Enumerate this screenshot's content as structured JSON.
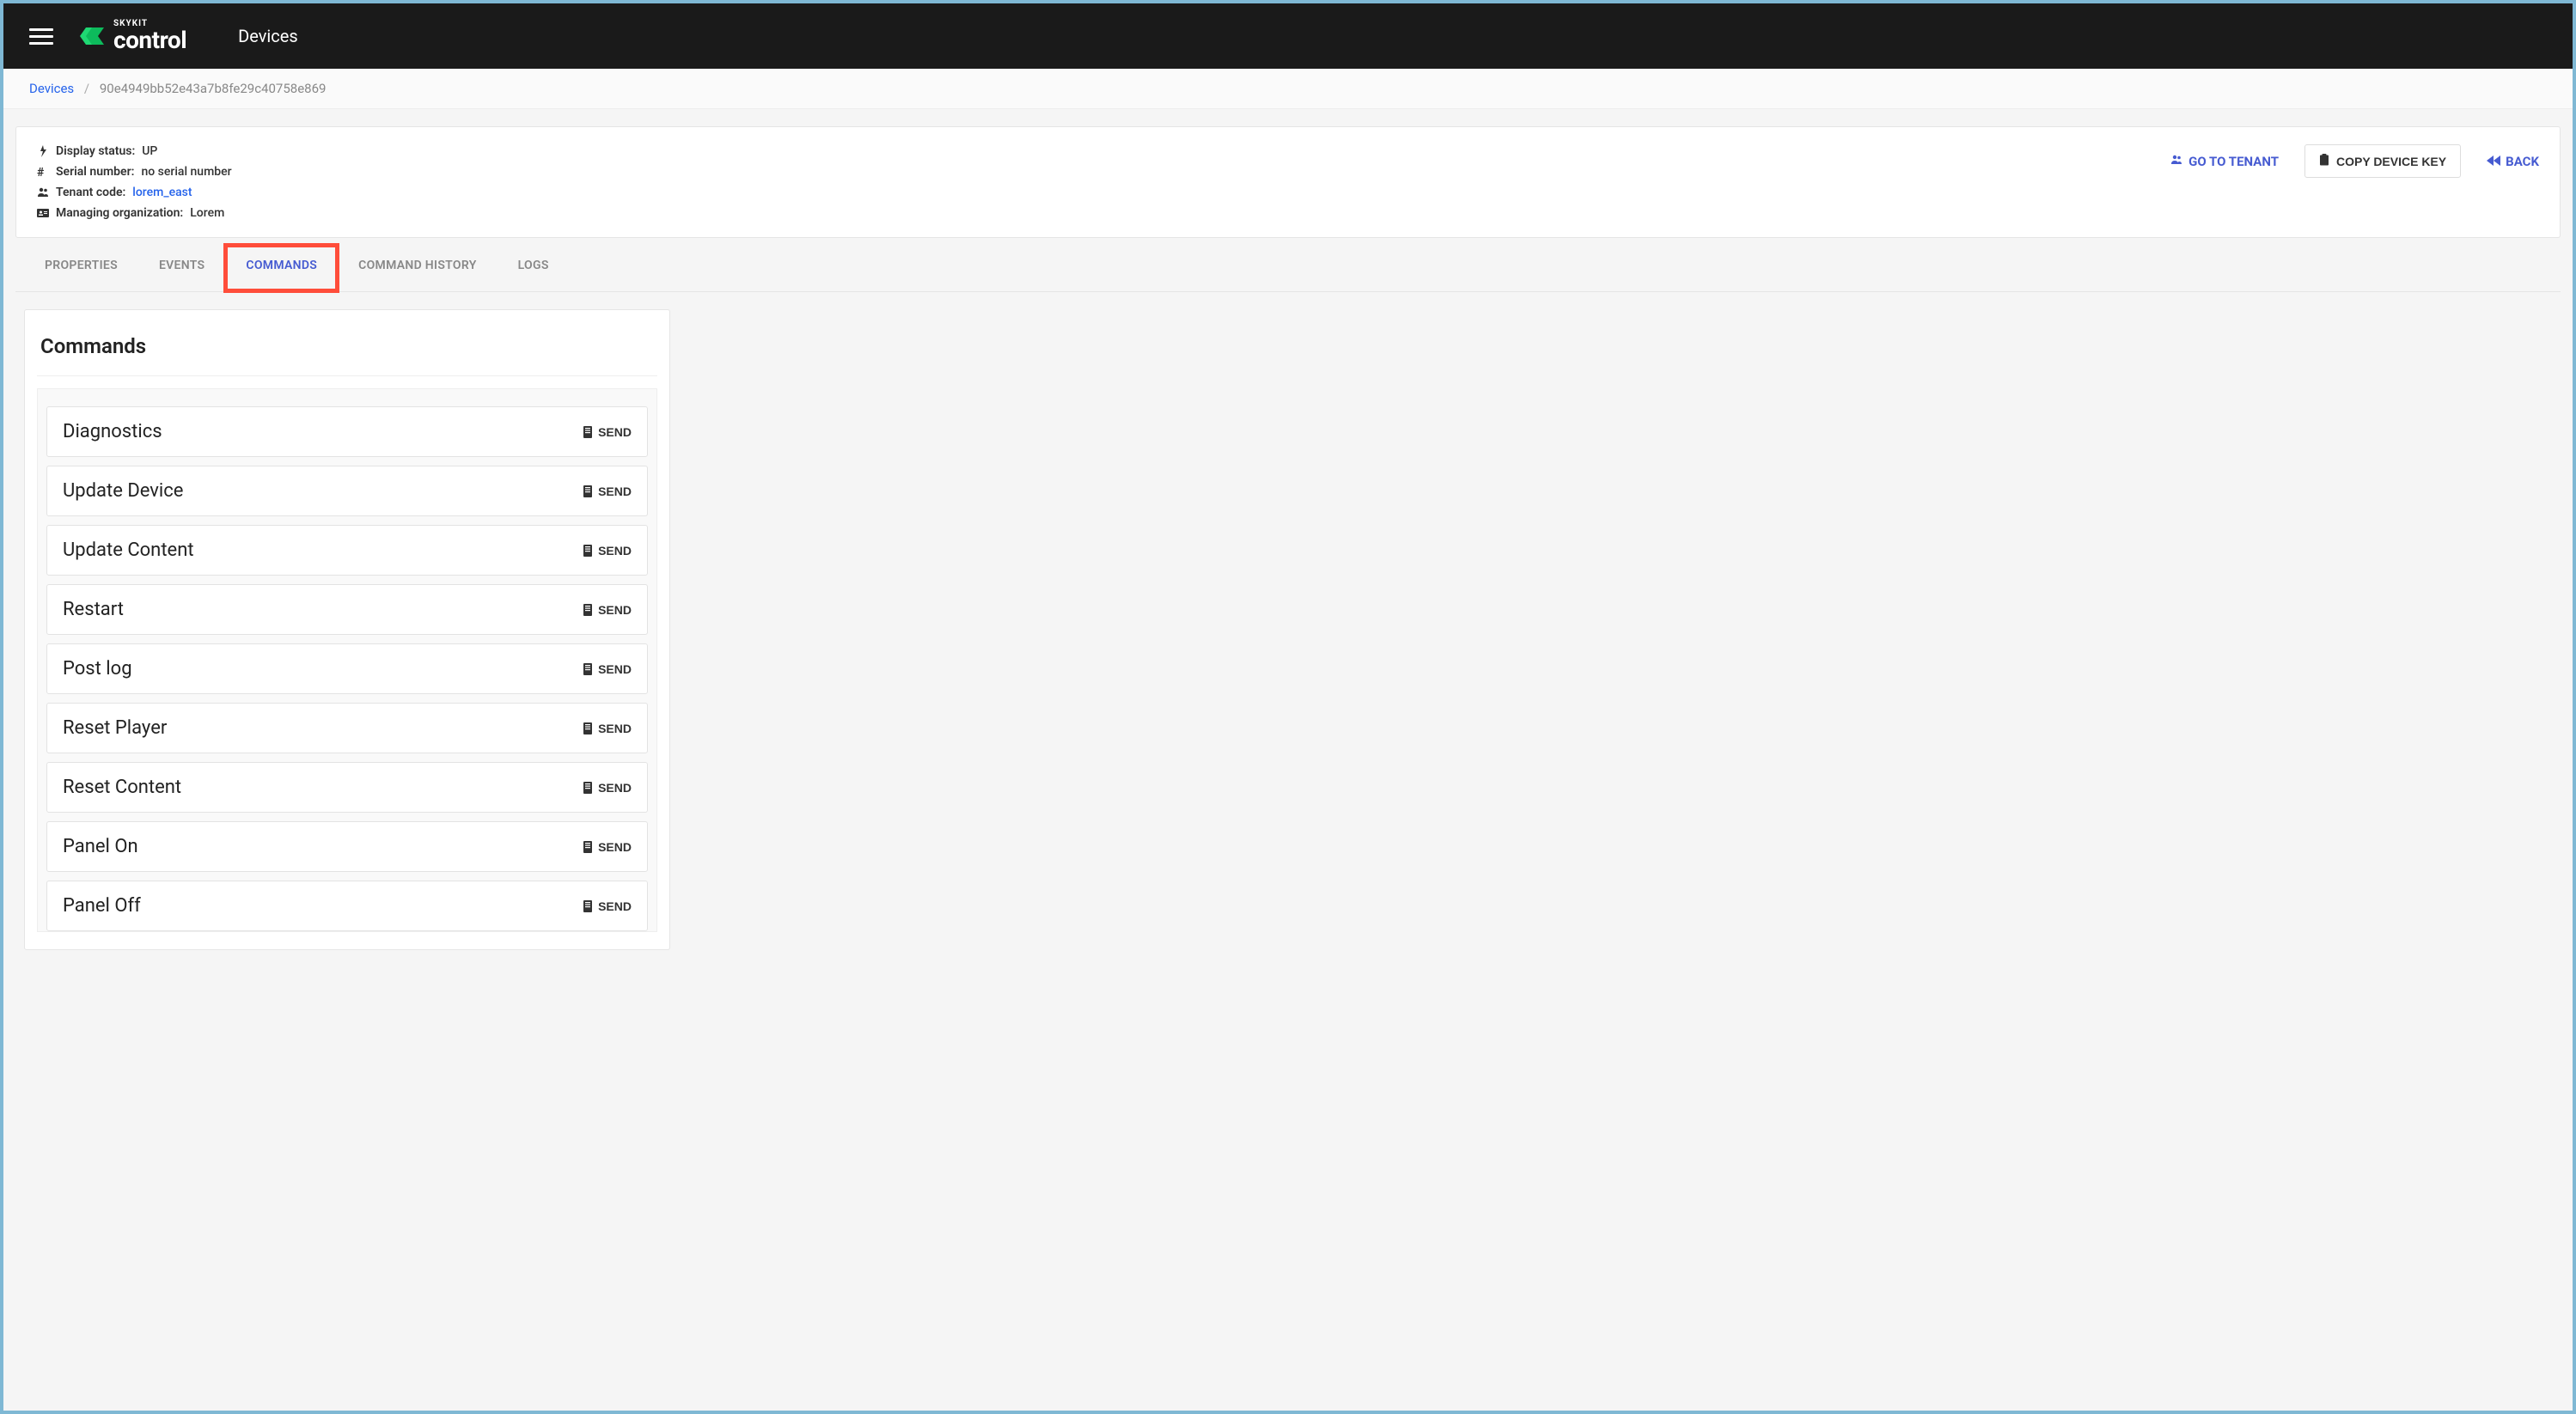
{
  "header": {
    "brand_small": "SKYKIT",
    "brand_big": "control",
    "page_title": "Devices"
  },
  "breadcrumb": {
    "parent": "Devices",
    "sep": "/",
    "current": "90e4949bb52e43a7b8fe29c40758e869"
  },
  "info": {
    "display_status_label": "Display status:",
    "display_status_value": "UP",
    "serial_label": "Serial number:",
    "serial_value": "no serial number",
    "tenant_label": "Tenant code:",
    "tenant_value": "lorem_east",
    "managing_label": "Managing organization:",
    "managing_value": "Lorem"
  },
  "actions": {
    "go_to_tenant": "GO TO TENANT",
    "copy_device_key": "COPY DEVICE KEY",
    "back": "BACK"
  },
  "tabs": [
    {
      "label": "PROPERTIES",
      "active": false
    },
    {
      "label": "EVENTS",
      "active": false
    },
    {
      "label": "COMMANDS",
      "active": true
    },
    {
      "label": "COMMAND HISTORY",
      "active": false
    },
    {
      "label": "LOGS",
      "active": false
    }
  ],
  "panel": {
    "title": "Commands",
    "send_label": "SEND",
    "commands": [
      "Diagnostics",
      "Update Device",
      "Update Content",
      "Restart",
      "Post log",
      "Reset Player",
      "Reset Content",
      "Panel On",
      "Panel Off"
    ]
  }
}
